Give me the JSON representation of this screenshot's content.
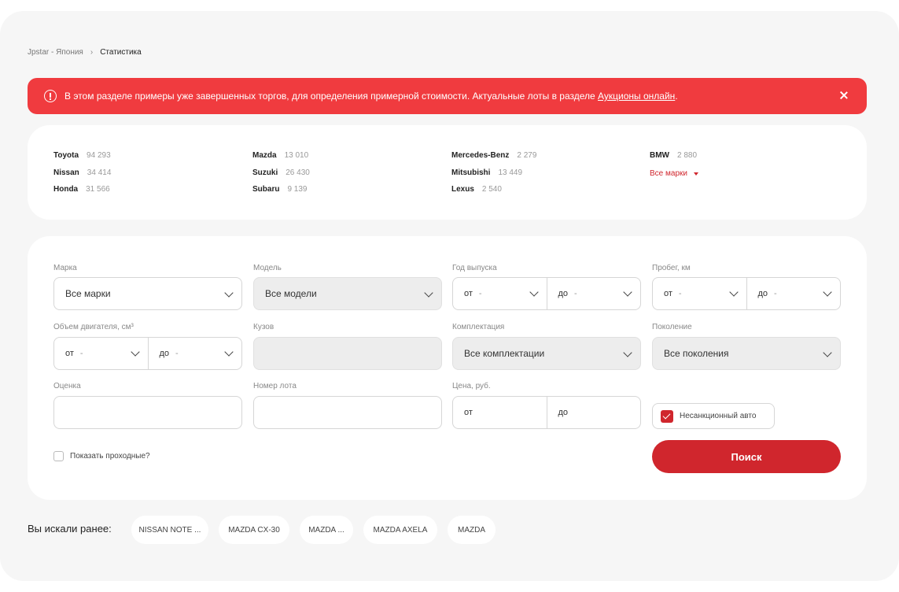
{
  "breadcrumb": {
    "home": "Jpstar - Япония",
    "separator": "›",
    "current": "Статистика"
  },
  "alert": {
    "text": "В этом разделе примеры уже завершенных торгов, для определения примерной стоимости. Актуальные лоты в разделе ",
    "link": "Аукционы онлайн",
    "tail": ".",
    "icon": "alert-circle-icon",
    "background": "#f03b3f"
  },
  "brands": {
    "items": [
      {
        "name": "Toyota",
        "count": "94 293"
      },
      {
        "name": "Nissan",
        "count": "34 414"
      },
      {
        "name": "Honda",
        "count": "31 566"
      },
      {
        "name": "Mazda",
        "count": "13 010"
      },
      {
        "name": "Suzuki",
        "count": "26 430"
      },
      {
        "name": "Subaru",
        "count": "9 139"
      },
      {
        "name": "Mercedes-Benz",
        "count": "2 279"
      },
      {
        "name": "Mitsubishi",
        "count": "13 449"
      },
      {
        "name": "Lexus",
        "count": "2 540"
      },
      {
        "name": "BMW",
        "count": "2 880"
      }
    ],
    "all_label": "Все марки",
    "accent": "#d0262d"
  },
  "filters": {
    "make_label": "Марка",
    "make_value": "Все марки",
    "model_label": "Модель",
    "model_value": "Все модели",
    "year_label": "Год выпуска",
    "year_from": "от",
    "year_to": "до",
    "mileage_label": "Пробег, км",
    "mileage_from": "от",
    "mileage_to": "до",
    "engine_label": "Объем двигателя, см³",
    "engine_from": "от",
    "engine_to": "до",
    "body_label": "Кузов",
    "trim_label": "Комплектация",
    "trim_value": "Все комплектации",
    "generation_label": "Поколение",
    "generation_value": "Все поколения",
    "grade_label": "Оценка",
    "lot_label": "Номер лота",
    "price_label": "Цена, руб.",
    "price_from": "от",
    "price_to": "до",
    "dash": "-",
    "show_passing": "Показать проходные?",
    "no_sanctions": "Несанкционный авто",
    "search": "Поиск"
  },
  "history": {
    "label": "Вы искали ранее:",
    "chips": [
      "NISSAN NOTE ...",
      "MAZDA CX-30",
      "MAZDA ...",
      "MAZDA AXELA",
      "MAZDA"
    ]
  }
}
